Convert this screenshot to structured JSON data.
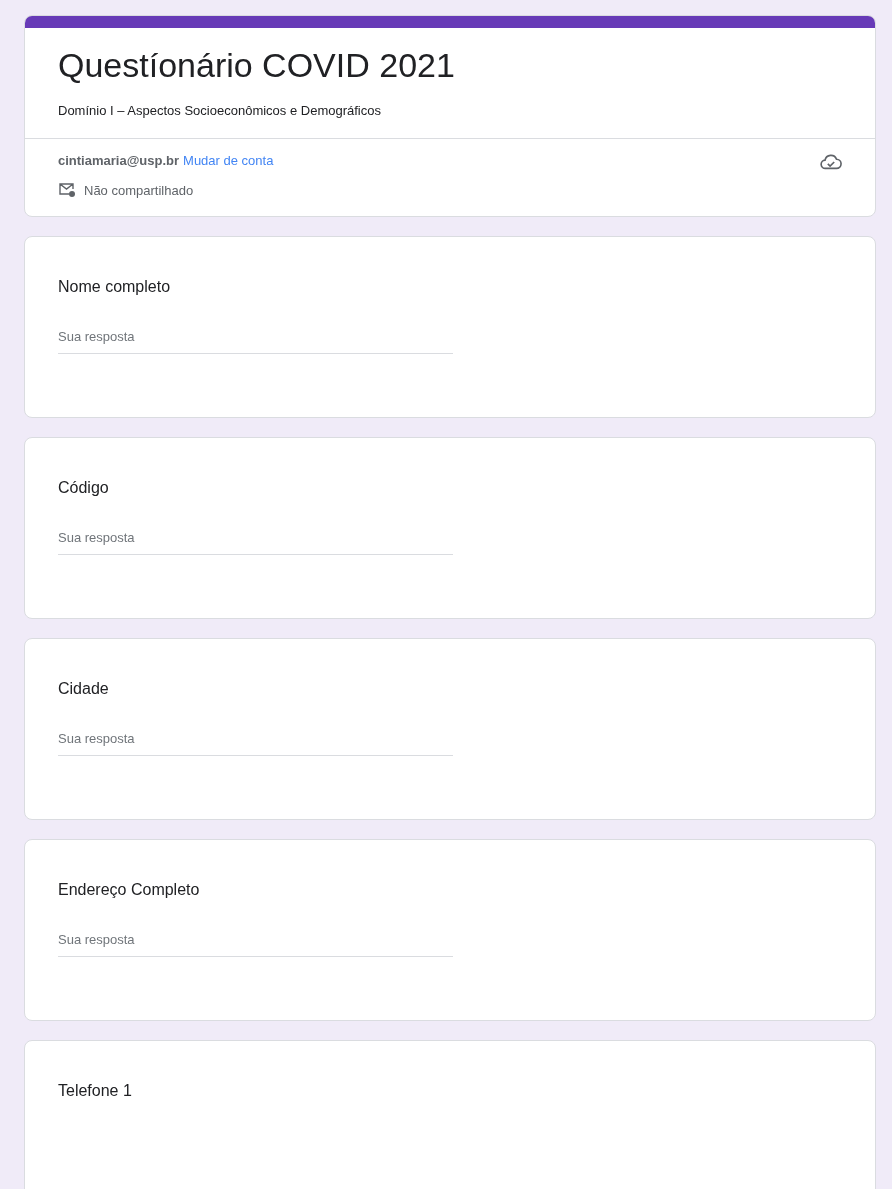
{
  "form": {
    "title": "Questíonário COVID 2021",
    "description": "Domínio I – Aspectos Socioeconômicos e Demográficos",
    "account": "cintiamaria@usp.br",
    "switch_account": "Mudar de conta",
    "sharing": "Não compartilhado"
  },
  "questions": [
    {
      "title": "Nome completo",
      "placeholder": "Sua resposta"
    },
    {
      "title": "Código",
      "placeholder": "Sua resposta"
    },
    {
      "title": "Cidade",
      "placeholder": "Sua resposta"
    },
    {
      "title": "Endereço Completo",
      "placeholder": "Sua resposta"
    },
    {
      "title": "Telefone 1"
    }
  ]
}
